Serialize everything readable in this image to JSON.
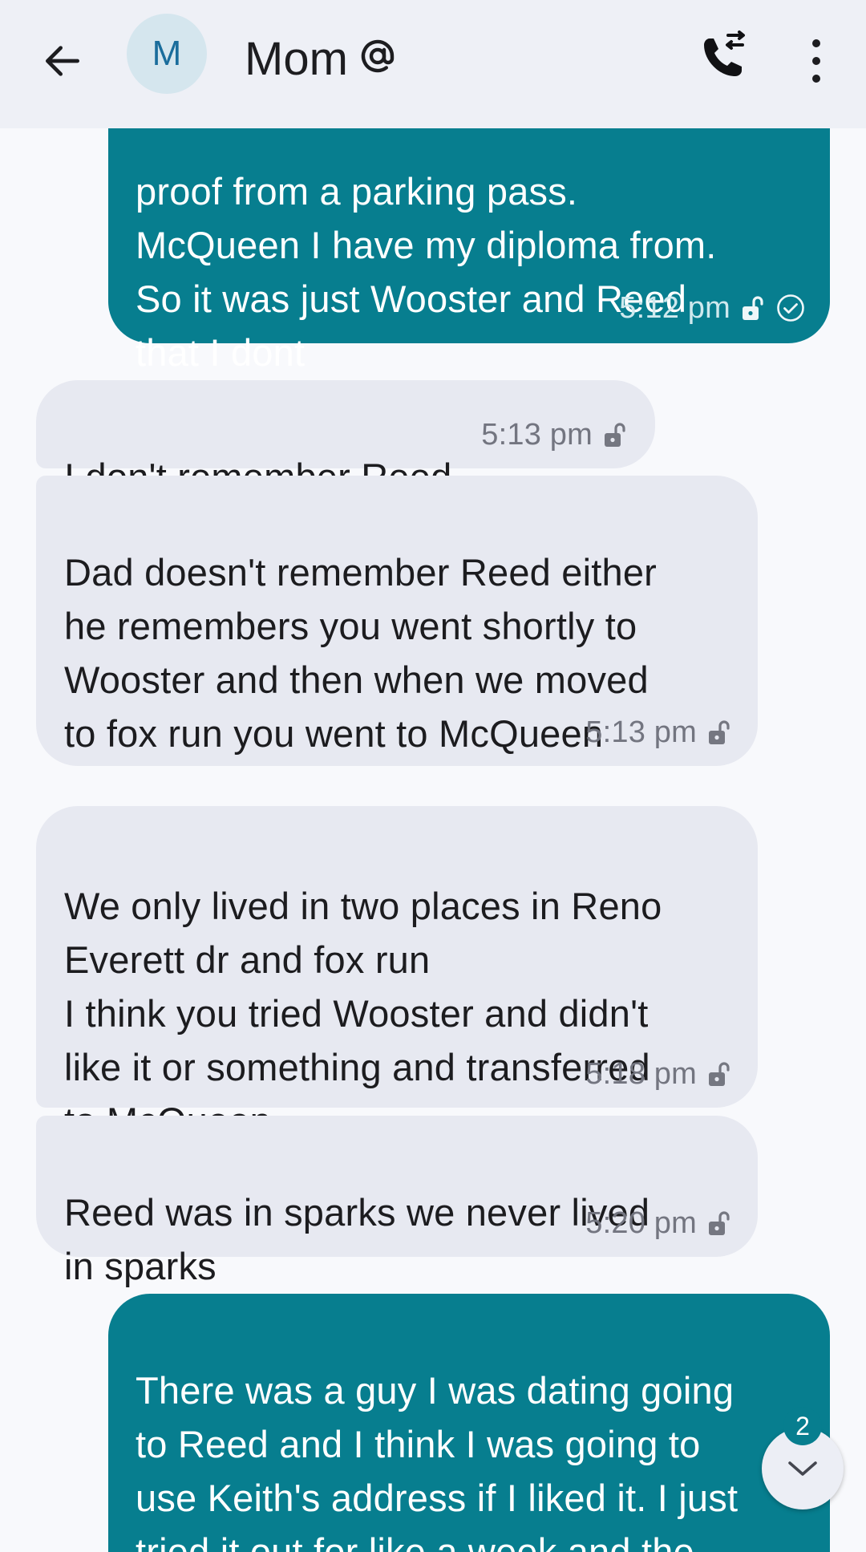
{
  "header": {
    "avatar_letter": "M",
    "contact_name": "Mom",
    "back_icon": "arrow-left-icon",
    "mention_icon": "at-sign-icon",
    "call_icon": "phone-call-icon",
    "menu_icon": "more-vertical-icon"
  },
  "messages": [
    {
      "direction": "outgoing",
      "text": "proof from a parking pass.\nMcQueen I have my diploma from.\nSo it was just Wooster and Reed\nthat I dont",
      "time": "5:12 pm",
      "status_icons": [
        "unlocked-icon",
        "delivered-check-icon"
      ]
    },
    {
      "direction": "incoming",
      "text": "I don't remember Reed",
      "time": "5:13 pm",
      "status_icons": [
        "unlocked-icon"
      ]
    },
    {
      "direction": "incoming",
      "text": "Dad doesn't remember Reed either\nhe remembers you went shortly to\nWooster and then when we moved\nto fox run you went to McQueen",
      "time": "5:13 pm",
      "status_icons": [
        "unlocked-icon"
      ]
    },
    {
      "direction": "incoming",
      "text": "We only lived in two places in Reno\nEverett dr and fox run\nI think you tried Wooster and didn't\nlike it or something and transferred\nto McQueen",
      "time": "5:18 pm",
      "status_icons": [
        "unlocked-icon"
      ]
    },
    {
      "direction": "incoming",
      "text": "Reed was in sparks we never lived\nin sparks",
      "time": "5:20 pm",
      "status_icons": [
        "unlocked-icon"
      ]
    },
    {
      "direction": "outgoing",
      "text": "There was a guy I was dating going\nto Reed and I think I was going to\nuse Keith's address if I liked it. I just\ntried it out for like a week and the\nguy and I broke up. I am not sure it",
      "time": "",
      "status_icons": []
    }
  ],
  "scroll_down": {
    "icon": "chevron-down-icon",
    "unread_count": "2"
  },
  "colors": {
    "outgoing_bubble": "#077e8f",
    "incoming_bubble": "#e7e9f1",
    "header_bg": "#eef0f6",
    "avatar_bg": "#d5e6ee",
    "avatar_text": "#1a6d9c"
  }
}
